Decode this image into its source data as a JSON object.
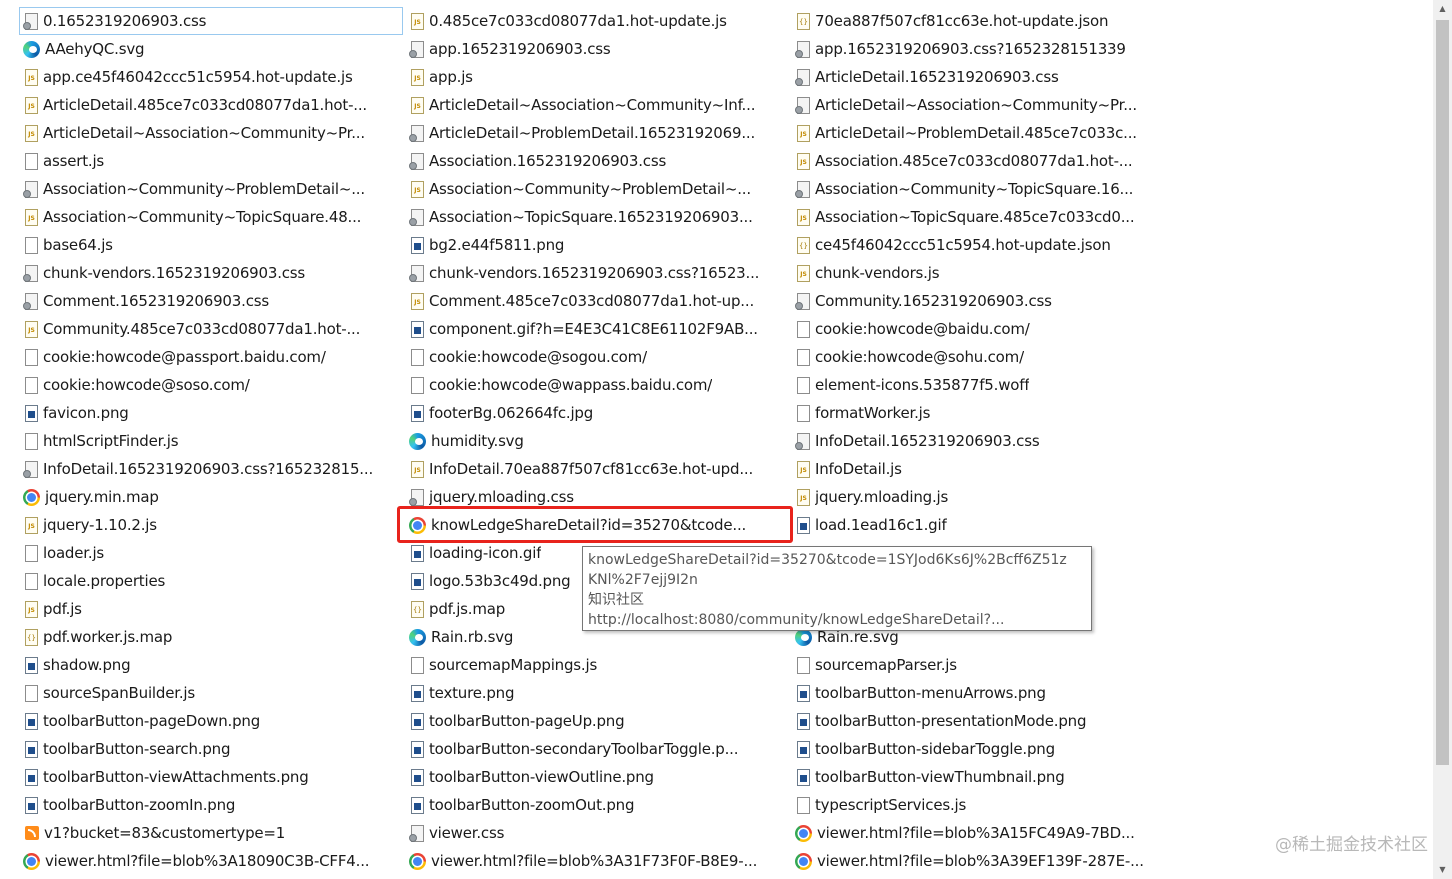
{
  "files": [
    [
      {
        "name": "0.1652319206903.css",
        "icon": "css-file-icon"
      },
      {
        "name": "AAehyQC.svg",
        "icon": "edge-icon"
      },
      {
        "name": "app.ce45f46042ccc51c5954.hot-update.js",
        "icon": "js-file-icon"
      },
      {
        "name": "ArticleDetail.485ce7c033cd08077da1.hot-...",
        "icon": "js-file-icon"
      },
      {
        "name": "ArticleDetail~Association~Community~Pr...",
        "icon": "js-file-icon"
      },
      {
        "name": "assert.js",
        "icon": "document-icon"
      },
      {
        "name": "Association~Community~ProblemDetail~...",
        "icon": "css-file-icon"
      },
      {
        "name": "Association~Community~TopicSquare.48...",
        "icon": "js-file-icon"
      },
      {
        "name": "base64.js",
        "icon": "document-icon"
      },
      {
        "name": "chunk-vendors.1652319206903.css",
        "icon": "css-file-icon"
      },
      {
        "name": "Comment.1652319206903.css",
        "icon": "css-file-icon"
      },
      {
        "name": "Community.485ce7c033cd08077da1.hot-...",
        "icon": "js-file-icon"
      },
      {
        "name": "cookie:howcode@passport.baidu.com/",
        "icon": "document-icon"
      },
      {
        "name": "cookie:howcode@soso.com/",
        "icon": "document-icon"
      },
      {
        "name": "favicon.png",
        "icon": "image-file-icon"
      },
      {
        "name": "htmlScriptFinder.js",
        "icon": "document-icon"
      },
      {
        "name": "InfoDetail.1652319206903.css?165232815...",
        "icon": "css-file-icon"
      },
      {
        "name": "jquery.min.map",
        "icon": "chrome-icon"
      },
      {
        "name": "jquery-1.10.2.js",
        "icon": "js-file-icon"
      },
      {
        "name": "loader.js",
        "icon": "document-icon"
      },
      {
        "name": "locale.properties",
        "icon": "document-icon"
      },
      {
        "name": "pdf.js",
        "icon": "js-file-icon"
      },
      {
        "name": "pdf.worker.js.map",
        "icon": "json-file-icon"
      },
      {
        "name": "shadow.png",
        "icon": "image-file-icon"
      },
      {
        "name": "sourceSpanBuilder.js",
        "icon": "document-icon"
      },
      {
        "name": "toolbarButton-pageDown.png",
        "icon": "image-file-icon"
      },
      {
        "name": "toolbarButton-search.png",
        "icon": "image-file-icon"
      },
      {
        "name": "toolbarButton-viewAttachments.png",
        "icon": "image-file-icon"
      },
      {
        "name": "toolbarButton-zoomIn.png",
        "icon": "image-file-icon"
      },
      {
        "name": "v1?bucket=83&customertype=1",
        "icon": "rss-feed-icon"
      },
      {
        "name": "viewer.html?file=blob%3A18090C3B-CFF4...",
        "icon": "chrome-icon"
      }
    ],
    [
      {
        "name": "0.485ce7c033cd08077da1.hot-update.js",
        "icon": "js-file-icon"
      },
      {
        "name": "app.1652319206903.css",
        "icon": "css-file-icon"
      },
      {
        "name": "app.js",
        "icon": "js-file-icon"
      },
      {
        "name": "ArticleDetail~Association~Community~Inf...",
        "icon": "js-file-icon"
      },
      {
        "name": "ArticleDetail~ProblemDetail.16523192069...",
        "icon": "css-file-icon"
      },
      {
        "name": "Association.1652319206903.css",
        "icon": "css-file-icon"
      },
      {
        "name": "Association~Community~ProblemDetail~...",
        "icon": "js-file-icon"
      },
      {
        "name": "Association~TopicSquare.1652319206903...",
        "icon": "css-file-icon"
      },
      {
        "name": "bg2.e44f5811.png",
        "icon": "image-file-icon"
      },
      {
        "name": "chunk-vendors.1652319206903.css?16523...",
        "icon": "css-file-icon"
      },
      {
        "name": "Comment.485ce7c033cd08077da1.hot-up...",
        "icon": "js-file-icon"
      },
      {
        "name": "component.gif?h=E4E3C41C8E61102F9AB...",
        "icon": "image-file-icon"
      },
      {
        "name": "cookie:howcode@sogou.com/",
        "icon": "document-icon"
      },
      {
        "name": "cookie:howcode@wappass.baidu.com/",
        "icon": "document-icon"
      },
      {
        "name": "footerBg.062664fc.jpg",
        "icon": "image-file-icon"
      },
      {
        "name": "humidity.svg",
        "icon": "edge-icon"
      },
      {
        "name": "InfoDetail.70ea887f507cf81cc63e.hot-upd...",
        "icon": "js-file-icon"
      },
      {
        "name": "jquery.mloading.css",
        "icon": "css-file-icon"
      },
      {
        "name": "knowLedgeShareDetail?id=35270&tcode...",
        "icon": "chrome-icon"
      },
      {
        "name": "loading-icon.gif",
        "icon": "image-file-icon"
      },
      {
        "name": "logo.53b3c49d.png",
        "icon": "image-file-icon"
      },
      {
        "name": "pdf.js.map",
        "icon": "json-file-icon"
      },
      {
        "name": "Rain.rb.svg",
        "icon": "edge-icon"
      },
      {
        "name": "sourcemapMappings.js",
        "icon": "document-icon"
      },
      {
        "name": "texture.png",
        "icon": "image-file-icon"
      },
      {
        "name": "toolbarButton-pageUp.png",
        "icon": "image-file-icon"
      },
      {
        "name": "toolbarButton-secondaryToolbarToggle.p...",
        "icon": "image-file-icon"
      },
      {
        "name": "toolbarButton-viewOutline.png",
        "icon": "image-file-icon"
      },
      {
        "name": "toolbarButton-zoomOut.png",
        "icon": "image-file-icon"
      },
      {
        "name": "viewer.css",
        "icon": "css-file-icon"
      },
      {
        "name": "viewer.html?file=blob%3A31F73F0F-B8E9-...",
        "icon": "chrome-icon"
      }
    ],
    [
      {
        "name": "70ea887f507cf81cc63e.hot-update.json",
        "icon": "json-file-icon"
      },
      {
        "name": "app.1652319206903.css?1652328151339",
        "icon": "css-file-icon"
      },
      {
        "name": "ArticleDetail.1652319206903.css",
        "icon": "css-file-icon"
      },
      {
        "name": "ArticleDetail~Association~Community~Pr...",
        "icon": "css-file-icon"
      },
      {
        "name": "ArticleDetail~ProblemDetail.485ce7c033c...",
        "icon": "js-file-icon"
      },
      {
        "name": "Association.485ce7c033cd08077da1.hot-...",
        "icon": "js-file-icon"
      },
      {
        "name": "Association~Community~TopicSquare.16...",
        "icon": "css-file-icon"
      },
      {
        "name": "Association~TopicSquare.485ce7c033cd0...",
        "icon": "js-file-icon"
      },
      {
        "name": "ce45f46042ccc51c5954.hot-update.json",
        "icon": "json-file-icon"
      },
      {
        "name": "chunk-vendors.js",
        "icon": "js-file-icon"
      },
      {
        "name": "Community.1652319206903.css",
        "icon": "css-file-icon"
      },
      {
        "name": "cookie:howcode@baidu.com/",
        "icon": "document-icon"
      },
      {
        "name": "cookie:howcode@sohu.com/",
        "icon": "document-icon"
      },
      {
        "name": "element-icons.535877f5.woff",
        "icon": "document-icon"
      },
      {
        "name": "formatWorker.js",
        "icon": "document-icon"
      },
      {
        "name": "InfoDetail.1652319206903.css",
        "icon": "css-file-icon"
      },
      {
        "name": "InfoDetail.js",
        "icon": "js-file-icon"
      },
      {
        "name": "jquery.mloading.js",
        "icon": "js-file-icon"
      },
      {
        "name": "load.1ead16c1.gif",
        "icon": "image-file-icon"
      },
      {
        "name": "",
        "icon": ""
      },
      {
        "name": "",
        "icon": ""
      },
      {
        "name": "",
        "icon": ""
      },
      {
        "name": "Rain.re.svg",
        "icon": "edge-icon"
      },
      {
        "name": "sourcemapParser.js",
        "icon": "document-icon"
      },
      {
        "name": "toolbarButton-menuArrows.png",
        "icon": "image-file-icon"
      },
      {
        "name": "toolbarButton-presentationMode.png",
        "icon": "image-file-icon"
      },
      {
        "name": "toolbarButton-sidebarToggle.png",
        "icon": "image-file-icon"
      },
      {
        "name": "toolbarButton-viewThumbnail.png",
        "icon": "image-file-icon"
      },
      {
        "name": "typescriptServices.js",
        "icon": "document-icon"
      },
      {
        "name": "viewer.html?file=blob%3A15FC49A9-7BD...",
        "icon": "chrome-icon"
      },
      {
        "name": "viewer.html?file=blob%3A39EF139F-287E-...",
        "icon": "chrome-icon"
      }
    ]
  ],
  "tooltip": {
    "line1": "knowLedgeShareDetail?id=35270&tcode=1SYJod6Ks6J%2Bcff6Z51z",
    "line2": "KNl%2F7ejj9I2n",
    "line3": "知识社区",
    "line4": "http://localhost:8080/community/knowLedgeShareDetail?..."
  },
  "highlight_color": "#e8231c",
  "selection_color": "#99c9ef",
  "watermark": "@稀土掘金技术社区"
}
